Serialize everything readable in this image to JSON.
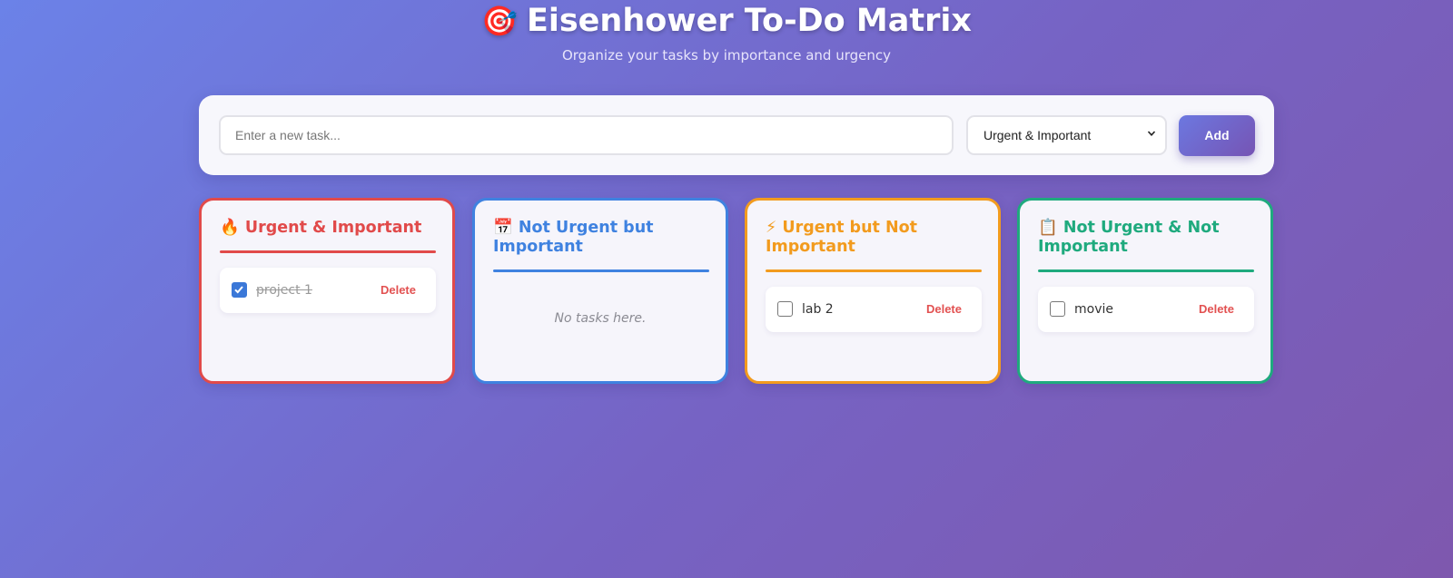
{
  "header": {
    "icon": "🎯",
    "title": "Eisenhower To-Do Matrix",
    "subtitle": "Organize your tasks by importance and urgency"
  },
  "add_form": {
    "placeholder": "Enter a new task...",
    "priority_selected": "Urgent & Important",
    "add_label": "Add"
  },
  "quadrants": [
    {
      "icon": "🔥",
      "title": "Urgent & Important",
      "color": "#e14a4a",
      "tasks": [
        {
          "text": "project 1",
          "done": true,
          "delete_label": "Delete"
        }
      ]
    },
    {
      "icon": "📅",
      "title": "Not Urgent but Important",
      "color": "#3f82e0",
      "tasks": [],
      "empty_text": "No tasks here."
    },
    {
      "icon": "⚡",
      "title": "Urgent but Not Important",
      "color": "#f29b1e",
      "tasks": [
        {
          "text": "lab 2",
          "done": false,
          "delete_label": "Delete"
        }
      ]
    },
    {
      "icon": "📋",
      "title": "Not Urgent & Not Important",
      "color": "#1faa7e",
      "tasks": [
        {
          "text": "movie",
          "done": false,
          "delete_label": "Delete"
        }
      ]
    }
  ]
}
